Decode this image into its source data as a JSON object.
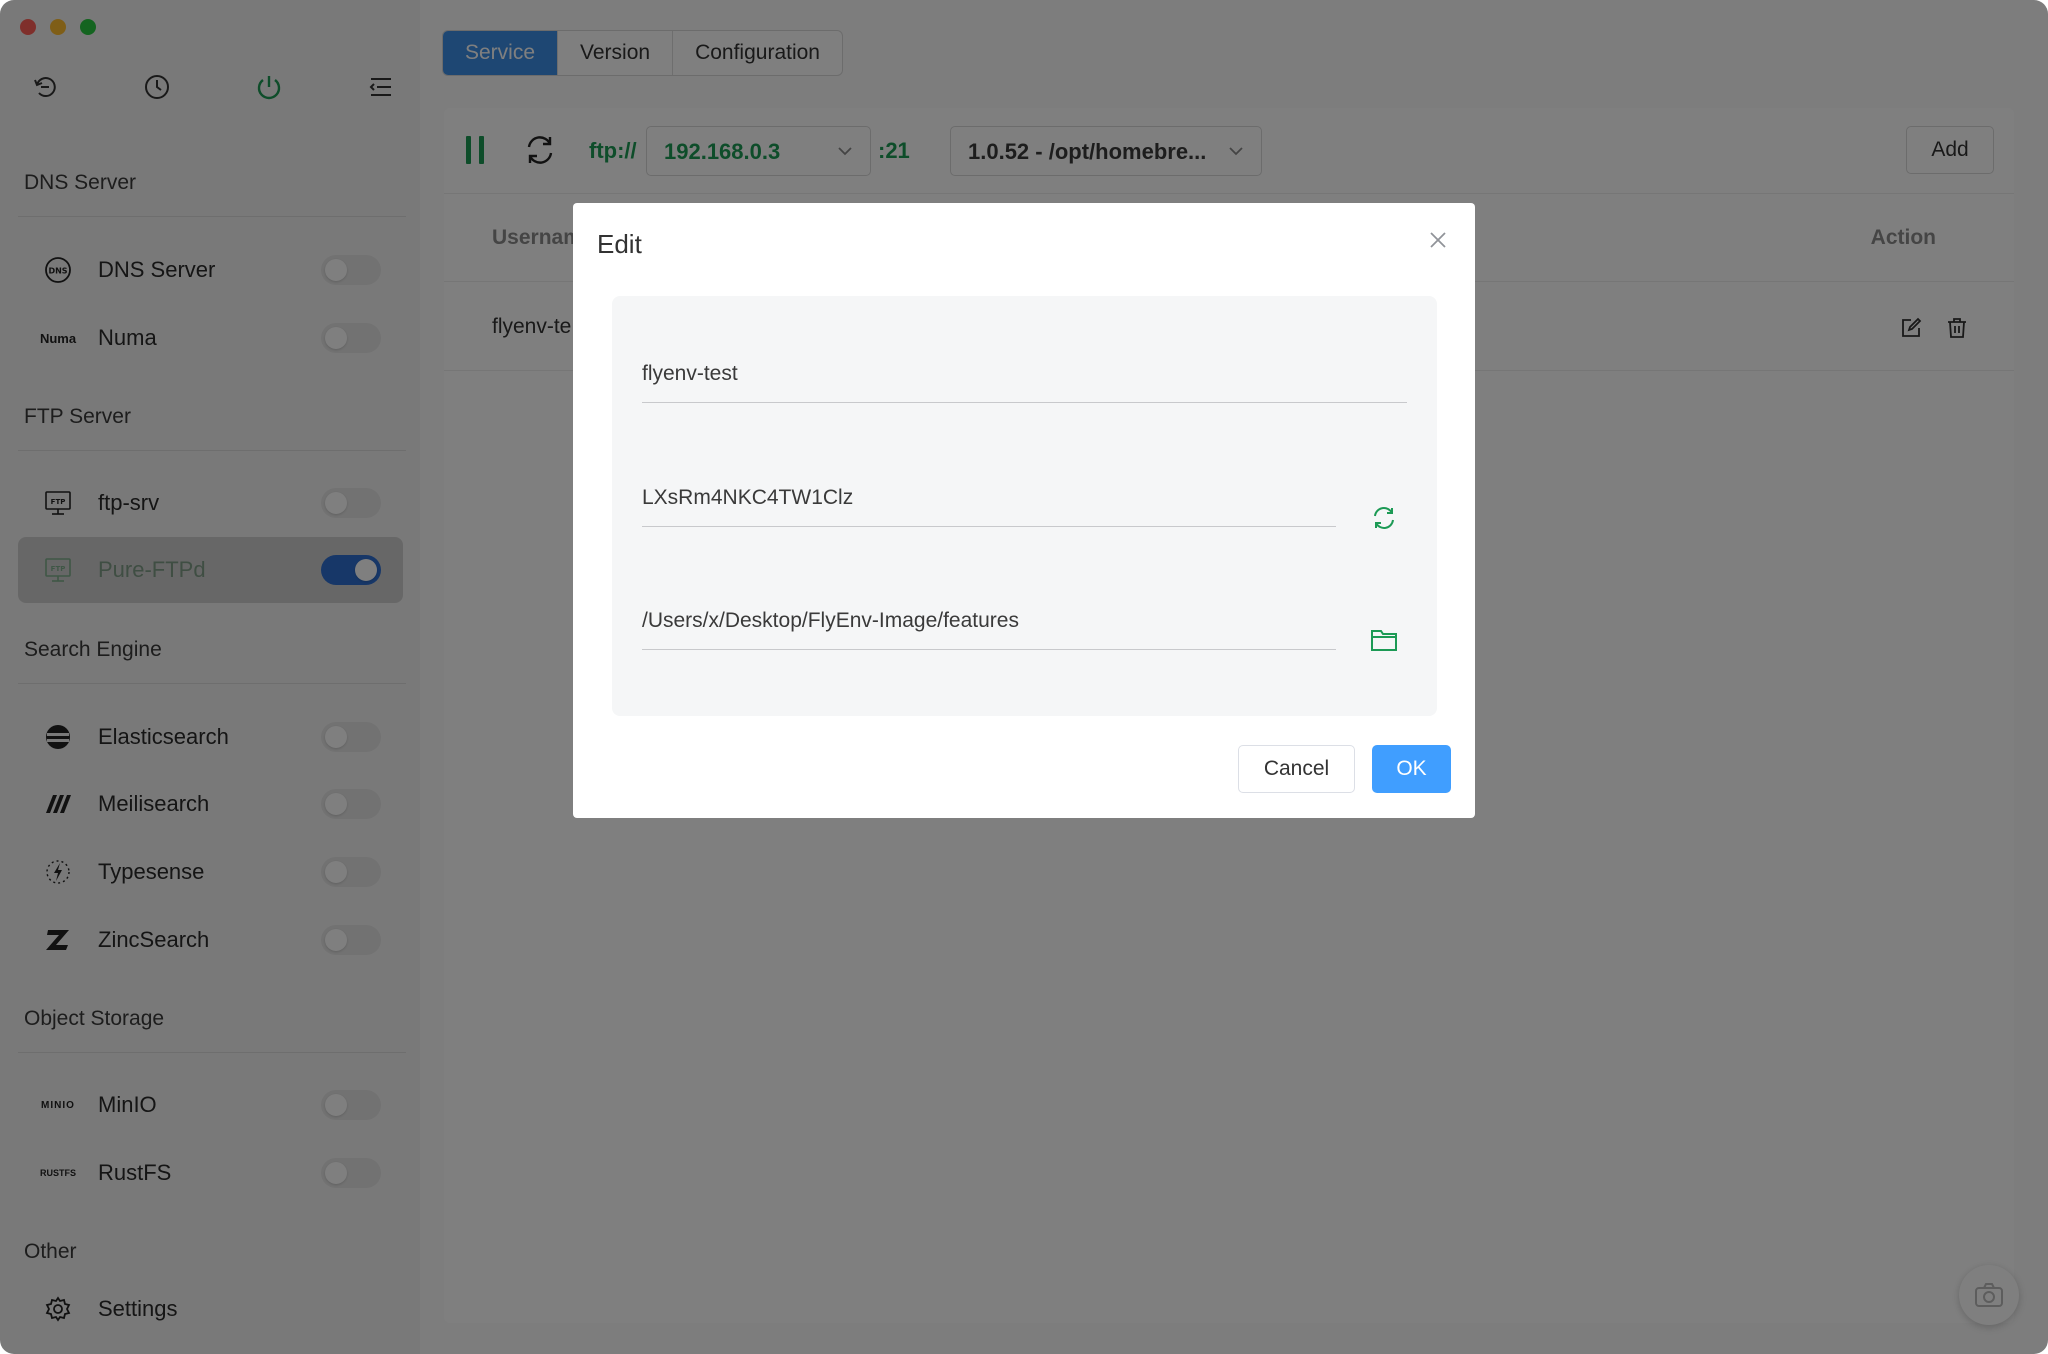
{
  "sidebar": {
    "top_icons": [
      "back-icon",
      "clock-icon",
      "power-icon",
      "menu-icon"
    ],
    "groups": {
      "dns": "DNS Server",
      "ftp": "FTP Server",
      "search": "Search Engine",
      "storage": "Object Storage",
      "other": "Other"
    },
    "items": {
      "dns_server": {
        "label": "DNS Server",
        "on": false
      },
      "numa": {
        "label": "Numa",
        "icon_text": "Numa",
        "on": false
      },
      "ftp_srv": {
        "label": "ftp-srv",
        "on": false
      },
      "pure_ftpd": {
        "label": "Pure-FTPd",
        "on": true
      },
      "elasticsearch": {
        "label": "Elasticsearch",
        "on": false
      },
      "meilisearch": {
        "label": "Meilisearch",
        "on": false
      },
      "typesense": {
        "label": "Typesense",
        "on": false
      },
      "zincsearch": {
        "label": "ZincSearch",
        "on": false
      },
      "minio": {
        "label": "MinIO",
        "icon_text": "MINIO",
        "on": false
      },
      "rustfs": {
        "label": "RustFS",
        "icon_text": "RUSTFS",
        "on": false
      },
      "settings": {
        "label": "Settings"
      }
    }
  },
  "tabs": {
    "service": "Service",
    "version": "Version",
    "configuration": "Configuration"
  },
  "toolbar": {
    "protocol": "ftp://",
    "ip": "192.168.0.3",
    "port": ":21",
    "version": "1.0.52 - /opt/homebre...",
    "add_label": "Add"
  },
  "table": {
    "col_username": "Usernam",
    "col_action": "Action",
    "rows": [
      {
        "username": "flyenv-te"
      }
    ]
  },
  "dialog": {
    "title": "Edit",
    "username_value": "flyenv-test",
    "password_value": "LXsRm4NKC4TW1Clz",
    "dir_value": "/Users/x/Desktop/FlyEnv-Image/features",
    "cancel_label": "Cancel",
    "ok_label": "OK"
  },
  "colors": {
    "accent_green": "#1c9a55",
    "tab_active": "#3d8fe6",
    "ok_button": "#409eff",
    "toggle_on": "#2f6fd0"
  }
}
